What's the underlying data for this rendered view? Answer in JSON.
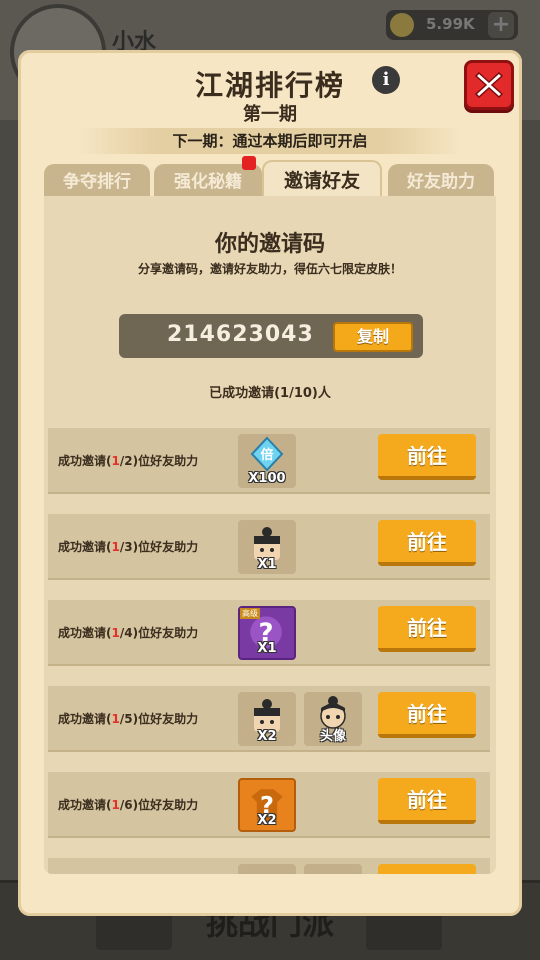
{
  "background": {
    "player_name": "小水",
    "coins": "5.99K",
    "bottom_label": "挑战门派"
  },
  "panel": {
    "title": "江湖排行榜",
    "subtitle": "第一期",
    "next_period_notice": "下一期：通过本期后即可开启",
    "info_icon": "info-icon",
    "close_icon": "close-icon"
  },
  "tabs": [
    {
      "label": "争夺排行",
      "active": false
    },
    {
      "label": "强化秘籍",
      "active": false,
      "badge": true
    },
    {
      "label": "邀请好友",
      "active": true
    },
    {
      "label": "好友助力",
      "active": false
    }
  ],
  "invite": {
    "title": "你的邀请码",
    "description": "分享邀请码，邀请好友助力，得伍六七限定皮肤！",
    "code": "214623043",
    "copy_label": "复制",
    "invited_status": "已成功邀请(1/10)人"
  },
  "rewards": [
    {
      "prefix": "成功邀请(",
      "current": "1",
      "suffix": "/2)位好友助力",
      "items": [
        {
          "icon": "double-diamond-icon",
          "count": "X100"
        }
      ],
      "button": "前往"
    },
    {
      "prefix": "成功邀请(",
      "current": "1",
      "suffix": "/3)位好友助力",
      "items": [
        {
          "icon": "character-skin-icon",
          "count": "X1"
        }
      ],
      "button": "前往"
    },
    {
      "prefix": "成功邀请(",
      "current": "1",
      "suffix": "/4)位好友助力",
      "items": [
        {
          "icon": "purple-mystery-icon",
          "count": "X1",
          "tag": "高级"
        }
      ],
      "button": "前往"
    },
    {
      "prefix": "成功邀请(",
      "current": "1",
      "suffix": "/5)位好友助力",
      "items": [
        {
          "icon": "character-skin-icon",
          "count": "X2"
        },
        {
          "icon": "avatar-icon",
          "count": "头像"
        }
      ],
      "button": "前往"
    },
    {
      "prefix": "成功邀请(",
      "current": "1",
      "suffix": "/6)位好友助力",
      "items": [
        {
          "icon": "orange-mystery-icon",
          "count": "X2"
        }
      ],
      "button": "前往"
    }
  ],
  "colors": {
    "panel_bg": "#f6e6c4",
    "accent_orange": "#f4aa1c",
    "close_red": "#e22a2a",
    "highlight_red": "#e3312a"
  }
}
